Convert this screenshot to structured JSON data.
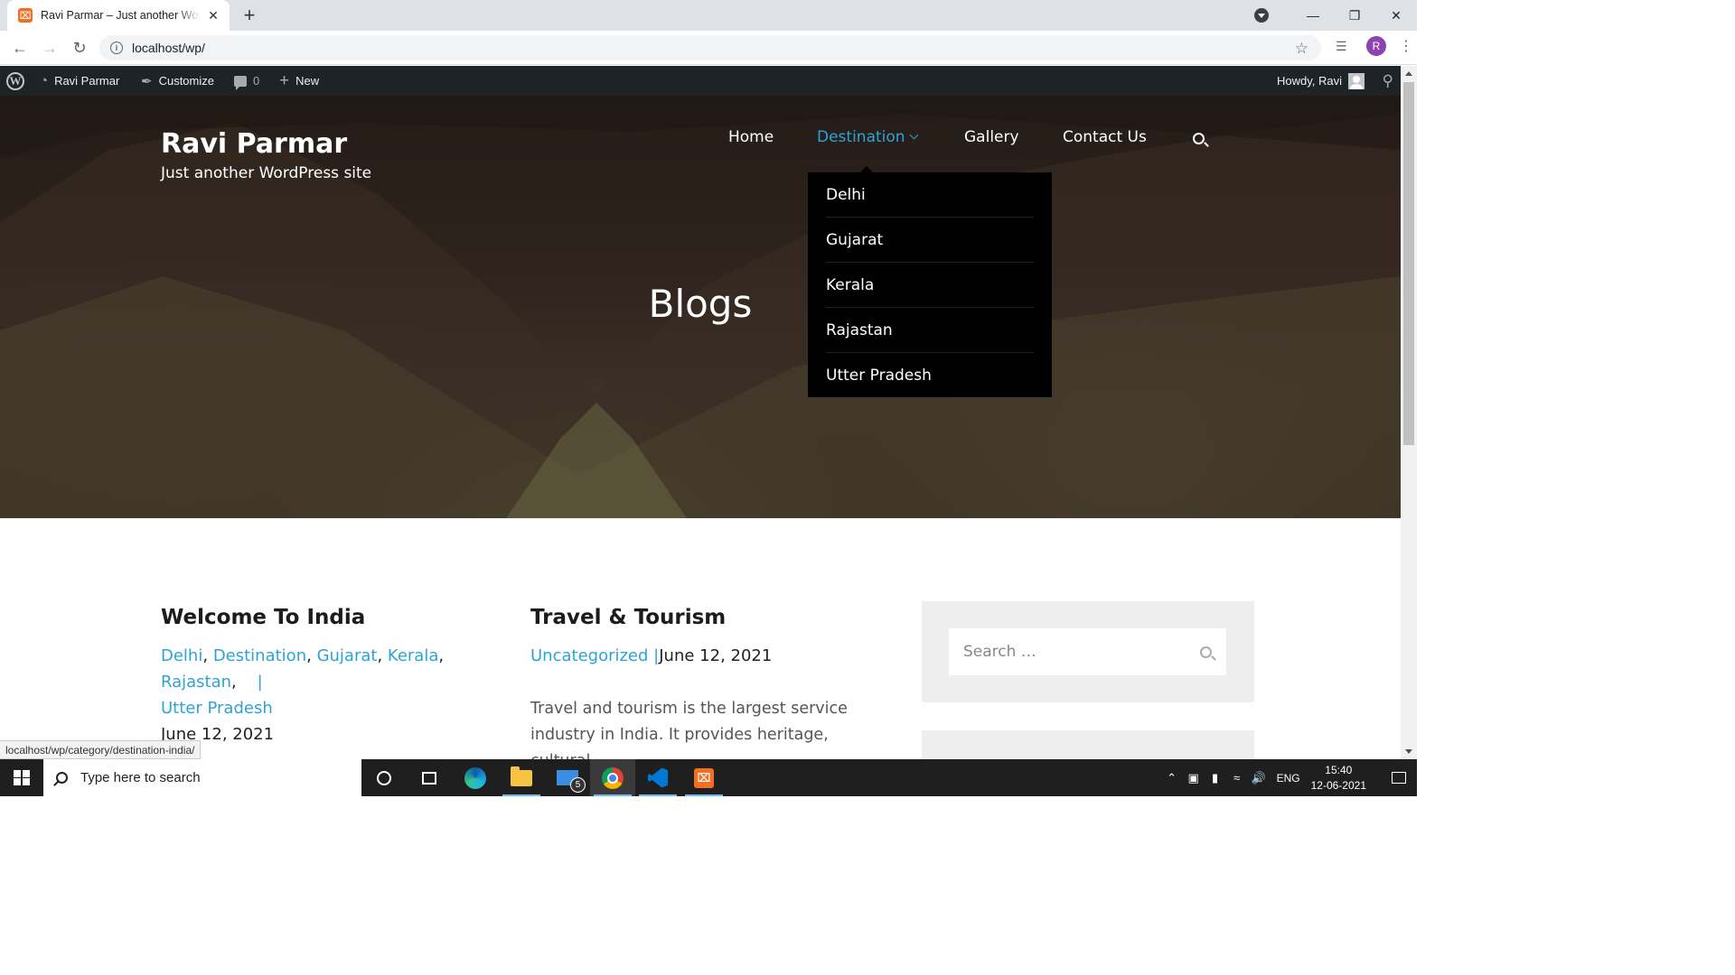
{
  "browser": {
    "tab_title": "Ravi Parmar – Just another WordPress site",
    "tab_favicon": "xampp-favicon",
    "url": "localhost/wp/",
    "profile_initial": "R",
    "status_url": "localhost/wp/category/destination-india/"
  },
  "admin_bar": {
    "site_name": "Ravi Parmar",
    "customize": "Customize",
    "comments_count": "0",
    "new": "New",
    "howdy": "Howdy, Ravi"
  },
  "hero": {
    "site_title": "Ravi Parmar",
    "site_description": "Just another WordPress site",
    "nav": {
      "home": "Home",
      "destination": "Destination",
      "gallery": "Gallery",
      "contact": "Contact Us"
    },
    "dropdown": [
      "Delhi",
      "Gujarat",
      "Kerala",
      "Rajastan",
      "Utter Pradesh"
    ],
    "heading": "Blogs"
  },
  "posts": [
    {
      "title": "Welcome To India",
      "categories": [
        "Delhi",
        "Destination",
        "Gujarat",
        "Kerala",
        "Rajastan",
        "Utter Pradesh"
      ],
      "date": "June 12, 2021"
    },
    {
      "title": "Travel & Tourism",
      "categories": [
        "Uncategorized"
      ],
      "date": "June 12, 2021",
      "excerpt_line1": "Travel and tourism is the largest service",
      "excerpt_line2": "industry in India. It provides heritage, cultural,"
    }
  ],
  "sidebar": {
    "search_placeholder": "Search …"
  },
  "taskbar": {
    "search_placeholder": "Type here to search",
    "mail_badge": "5",
    "language": "ENG",
    "time": "15:40",
    "date": "12-06-2021"
  },
  "colors": {
    "accent": "#2ea3d6",
    "admin_bar": "#1d2327",
    "dropdown_bg": "#000000"
  }
}
